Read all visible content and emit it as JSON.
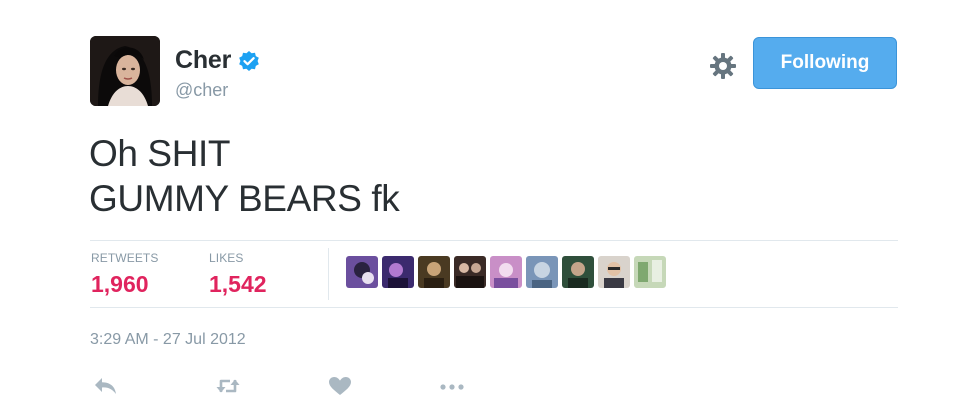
{
  "user": {
    "display_name": "Cher",
    "handle": "@cher",
    "avatar_icon": "profile-photo",
    "verified_icon": "verified-badge-icon"
  },
  "header": {
    "settings_icon": "gear-icon",
    "follow_label": "Following"
  },
  "tweet": {
    "lines": [
      "Oh SHIT",
      "GUMMY BEARS fk"
    ]
  },
  "stats": {
    "retweets_label": "RETWEETS",
    "retweets_value": "1,960",
    "likes_label": "LIKES",
    "likes_value": "1,542"
  },
  "likers": [
    {
      "name": "liker-avatar-1",
      "color": "#6b4f9e"
    },
    {
      "name": "liker-avatar-2",
      "color": "#3b2a6e"
    },
    {
      "name": "liker-avatar-3",
      "color": "#4a3a22"
    },
    {
      "name": "liker-avatar-4",
      "color": "#3a2a26"
    },
    {
      "name": "liker-avatar-5",
      "color": "#c98fc7"
    },
    {
      "name": "liker-avatar-6",
      "color": "#7a95b8"
    },
    {
      "name": "liker-avatar-7",
      "color": "#2f4f3b"
    },
    {
      "name": "liker-avatar-8",
      "color": "#d9d3cc"
    },
    {
      "name": "liker-avatar-9",
      "color": "#c6d8b8"
    }
  ],
  "timestamp": "3:29 AM - 27 Jul 2012",
  "actions": {
    "reply_icon": "reply-icon",
    "retweet_icon": "retweet-icon",
    "like_icon": "heart-icon",
    "more_icon": "more-icon"
  },
  "colors": {
    "accent": "#55acee",
    "count": "#e0245e",
    "muted": "#8899a6",
    "verified": "#1da1f2"
  }
}
